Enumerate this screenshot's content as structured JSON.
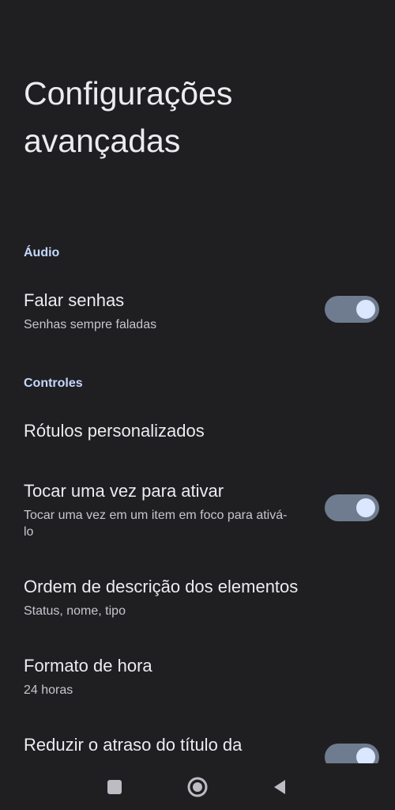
{
  "page": {
    "title": "Configurações avançadas"
  },
  "sections": {
    "audio": {
      "header": "Áudio",
      "speak_passwords": {
        "title": "Falar senhas",
        "subtitle": "Senhas sempre faladas",
        "enabled": true
      }
    },
    "controls": {
      "header": "Controles",
      "custom_labels": {
        "title": "Rótulos personalizados"
      },
      "single_tap": {
        "title": "Tocar uma vez para ativar",
        "subtitle": "Tocar uma vez em um item em foco para ativá-lo",
        "enabled": true
      },
      "description_order": {
        "title": "Ordem de descrição dos elementos",
        "subtitle": "Status, nome, tipo"
      },
      "time_format": {
        "title": "Formato de hora",
        "subtitle": "24 horas"
      },
      "reduce_delay": {
        "title": "Reduzir o atraso do título da",
        "enabled": true
      }
    }
  },
  "colors": {
    "background": "#1f1f22",
    "accent": "#c4d8ff",
    "switch_track": "#6f7c8f",
    "switch_knob": "#dbe6ff"
  },
  "navigation": {
    "recents_icon": "square-icon",
    "home_icon": "home-circle-icon",
    "back_icon": "back-triangle-icon"
  }
}
